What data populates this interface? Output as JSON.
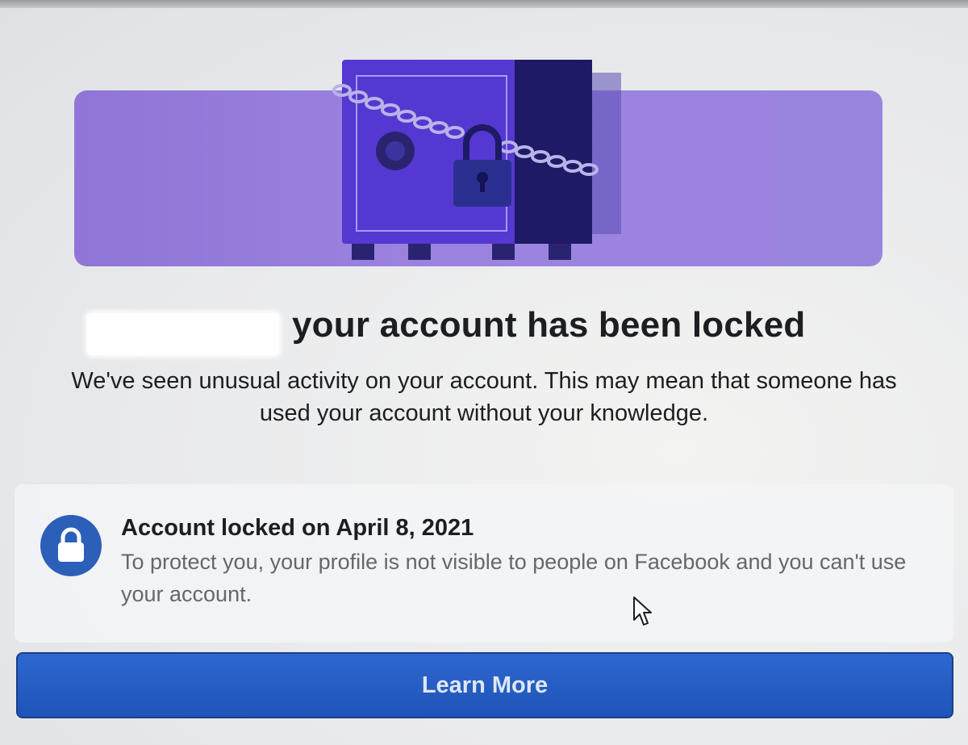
{
  "headline": "your account has been locked",
  "description": "We've seen unusual activity on your account. This may mean that someone has used your account without your knowledge.",
  "info": {
    "title": "Account locked on April 8, 2021",
    "body": "To protect you, your profile is not visible to people on Facebook and you can't use your account."
  },
  "button": {
    "label": "Learn More"
  },
  "icons": {
    "hero": "locked-safe-icon",
    "badge": "lock-icon",
    "pointer": "mouse-cursor-icon"
  },
  "colors": {
    "banner": "#9b83e0",
    "safe": "#5b3fcf",
    "badge": "#2b5fb8",
    "button": "#2563c8"
  }
}
